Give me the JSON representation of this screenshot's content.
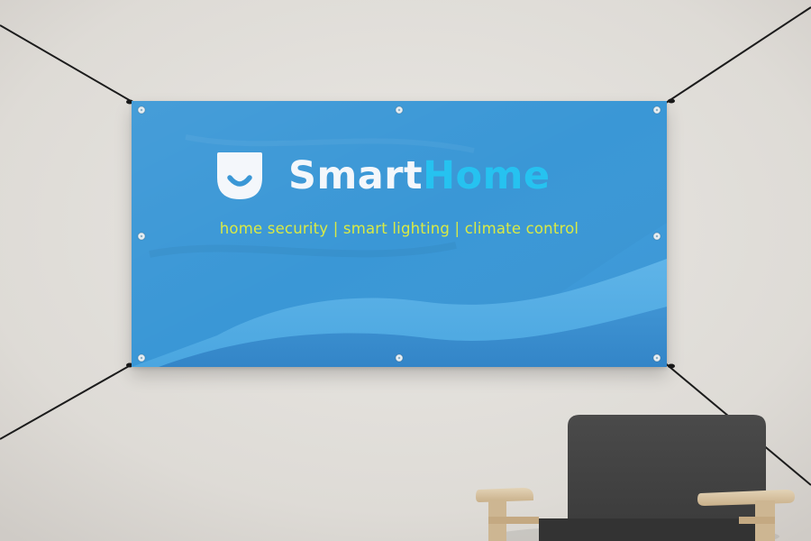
{
  "banner": {
    "brand": {
      "part_1": "Smart",
      "part_2": "Home"
    },
    "tagline": "home security | smart lighting | climate control",
    "logo_icon": "smiling-face-shield-icon"
  },
  "colors": {
    "banner_background": "#3a97d6",
    "brand_part_1": "#f4f7fb",
    "brand_part_2": "#26c2f0",
    "tagline": "#d9ea45",
    "wall": "#e2dfdb"
  }
}
